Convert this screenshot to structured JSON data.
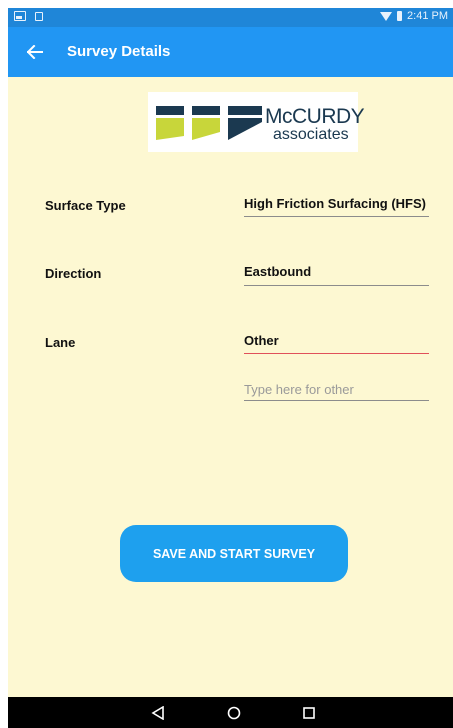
{
  "status_bar": {
    "time": "2:41 PM",
    "icons": [
      "image-icon",
      "square-icon",
      "wifi-icon",
      "battery-icon"
    ]
  },
  "app_bar": {
    "title": "Survey Details",
    "back_icon": "arrow-left-icon"
  },
  "logo": {
    "line1": "McCURDY",
    "line2": "associates",
    "colors": {
      "dark": "#1b3950",
      "green": "#c8d63a"
    }
  },
  "form": {
    "surface_type": {
      "label": "Surface Type",
      "value": "High Friction Surfacing (HFS)"
    },
    "direction": {
      "label": "Direction",
      "value": "Eastbound"
    },
    "lane": {
      "label": "Lane",
      "value": "Other"
    },
    "other_input": {
      "value": "",
      "placeholder": "Type here for other"
    }
  },
  "actions": {
    "save_label": "SAVE AND START SURVEY"
  },
  "nav_bar": {
    "icons": [
      "back-triangle-icon",
      "home-circle-icon",
      "recents-square-icon"
    ]
  },
  "colors": {
    "primary": "#2196f3",
    "status_bar": "#1f86d8",
    "background": "#fdf8d2",
    "button": "#1ea0ee",
    "active_underline": "#e0505a"
  }
}
